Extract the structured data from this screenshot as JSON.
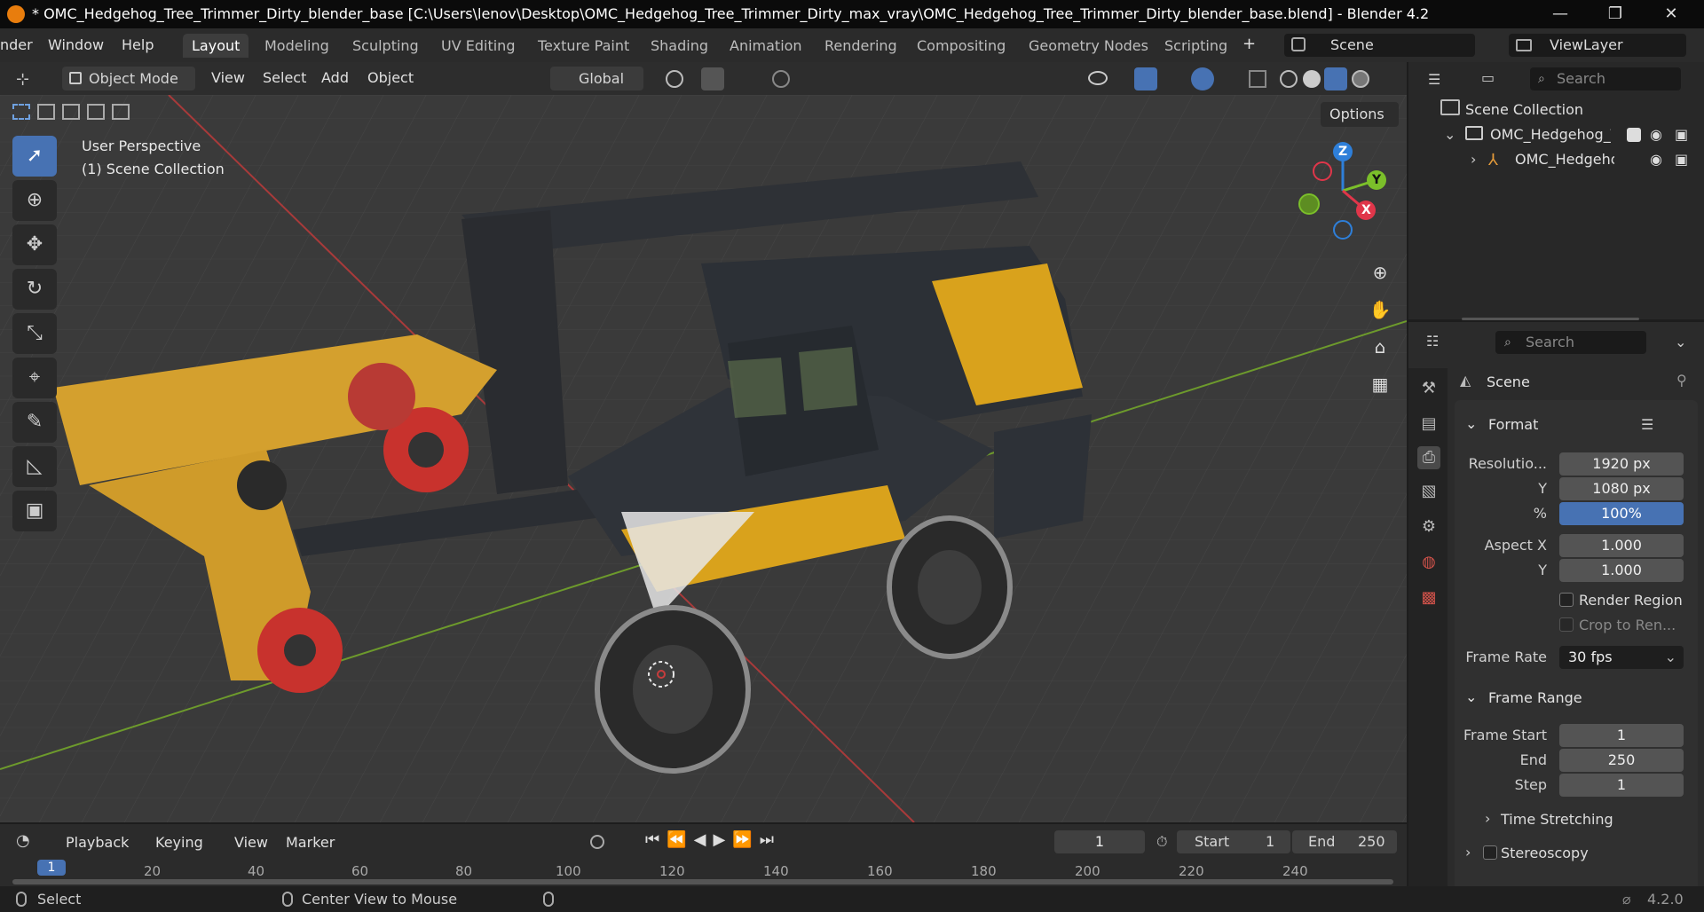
{
  "window": {
    "title": "* OMC_Hedgehog_Tree_Trimmer_Dirty_blender_base [C:\\Users\\lenov\\Desktop\\OMC_Hedgehog_Tree_Trimmer_Dirty_max_vray\\OMC_Hedgehog_Tree_Trimmer_Dirty_blender_base.blend] - Blender 4.2",
    "controls": {
      "minimize": "—",
      "maximize": "❐",
      "close": "✕"
    }
  },
  "menubar": {
    "menus": [
      "nder",
      "Window",
      "Help"
    ],
    "tabs": [
      "Layout",
      "Modeling",
      "Sculpting",
      "UV Editing",
      "Texture Paint",
      "Shading",
      "Animation",
      "Rendering",
      "Compositing",
      "Geometry Nodes",
      "Scripting"
    ],
    "active_tab": "Layout",
    "add_tab": "+",
    "scene": "Scene",
    "view_layer": "ViewLayer"
  },
  "viewport_header": {
    "mode": "Object Mode",
    "menus": [
      "View",
      "Select",
      "Add",
      "Object"
    ],
    "transform_orientation": "Global",
    "options": "Options"
  },
  "viewport": {
    "perspective": "User Perspective",
    "collection": "(1) Scene Collection",
    "gizmo_axes": [
      "Z",
      "Y",
      "X"
    ],
    "tools": [
      "select-box",
      "cursor",
      "move",
      "rotate",
      "scale",
      "transform",
      "annotate",
      "measure",
      "add-cube"
    ]
  },
  "outliner": {
    "search_placeholder": "Search",
    "root": "Scene Collection",
    "items": [
      {
        "label": "OMC_Hedgehog_Tr"
      },
      {
        "label": "OMC_Hedgeho"
      }
    ]
  },
  "properties": {
    "search_placeholder": "Search",
    "context": "Scene",
    "format_title": "Format",
    "resolution_x_label": "Resolutio...",
    "resolution_x": "1920 px",
    "resolution_y_label": "Y",
    "resolution_y": "1080 px",
    "resolution_pct_label": "%",
    "resolution_pct": "100%",
    "aspect_x_label": "Aspect X",
    "aspect_x": "1.000",
    "aspect_y_label": "Y",
    "aspect_y": "1.000",
    "render_region": "Render Region",
    "crop": "Crop to Ren...",
    "frame_rate_label": "Frame Rate",
    "frame_rate": "30 fps",
    "frame_range_title": "Frame Range",
    "frame_start_label": "Frame Start",
    "frame_start": "1",
    "end_label": "End",
    "end": "250",
    "step_label": "Step",
    "step": "1",
    "time_stretching": "Time Stretching",
    "stereoscopy": "Stereoscopy"
  },
  "timeline": {
    "menus": [
      "Playback",
      "Keying",
      "View",
      "Marker"
    ],
    "current_frame": "1",
    "start_label": "Start",
    "start": "1",
    "end_label": "End",
    "end": "250",
    "ticks": [
      "1",
      "20",
      "40",
      "60",
      "80",
      "100",
      "120",
      "140",
      "160",
      "180",
      "200",
      "220",
      "240"
    ]
  },
  "status": {
    "select": "Select",
    "center_view": "Center View to Mouse",
    "version": "4.2.0"
  },
  "colors": {
    "accent": "#4772b3",
    "body_yellow": "#d9a21c",
    "body_dark": "#2c3036",
    "wheel_red": "#c8322d"
  }
}
